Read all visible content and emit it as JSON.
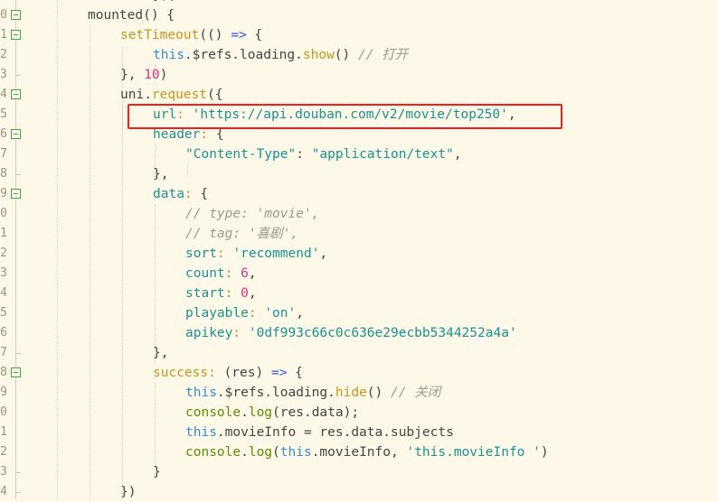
{
  "editor": {
    "line_numbers": [
      "0",
      "1",
      "2",
      "3",
      "4",
      "5",
      "6",
      "7",
      "8",
      "9",
      "0",
      "1",
      "2",
      "3",
      "4",
      "5",
      "6",
      "7",
      "8",
      "9",
      "0",
      "1",
      "2",
      "3",
      "4"
    ],
    "fold_lines": [
      0,
      1,
      4,
      6,
      9,
      18
    ],
    "tick_lines": [
      3,
      8,
      17,
      23,
      24
    ],
    "highlight": {
      "color": "#f01e1e",
      "line": 5
    },
    "lines": [
      {
        "indent": 2,
        "tokens": [
          [
            "}),",
            "def"
          ]
        ]
      },
      {
        "indent": 0,
        "tokens": [
          [
            "mounted() {",
            "def"
          ]
        ]
      },
      {
        "indent": 1,
        "tokens": [
          [
            "setTimeout",
            "fn"
          ],
          [
            "(() ",
            "def"
          ],
          [
            "=>",
            "arrow"
          ],
          [
            " {",
            "def"
          ]
        ]
      },
      {
        "indent": 2,
        "tokens": [
          [
            "this",
            "kw"
          ],
          [
            ".$refs.loading.",
            "def"
          ],
          [
            "show",
            "fn"
          ],
          [
            "() ",
            "def"
          ],
          [
            "// 打开",
            "com"
          ]
        ]
      },
      {
        "indent": 1,
        "tokens": [
          [
            "}, ",
            "def"
          ],
          [
            "10",
            "num"
          ],
          [
            ")",
            "def"
          ]
        ]
      },
      {
        "indent": 1,
        "tokens": [
          [
            "uni.",
            "def"
          ],
          [
            "request",
            "fn"
          ],
          [
            "({",
            "def"
          ]
        ]
      },
      {
        "indent": 2,
        "tokens": [
          [
            "url",
            "key"
          ],
          [
            ": ",
            "punc"
          ],
          [
            "'https://api.douban.com/v2/movie/top250'",
            "str"
          ],
          [
            ",",
            "def"
          ]
        ]
      },
      {
        "indent": 2,
        "tokens": [
          [
            "header",
            "key"
          ],
          [
            ": ",
            "punc"
          ],
          [
            "{",
            "def"
          ]
        ]
      },
      {
        "indent": 3,
        "tokens": [
          [
            "\"Content-Type\"",
            "str"
          ],
          [
            ": ",
            "def"
          ],
          [
            "\"application/text\"",
            "str"
          ],
          [
            ",",
            "def"
          ]
        ]
      },
      {
        "indent": 2,
        "tokens": [
          [
            "},",
            "def"
          ]
        ]
      },
      {
        "indent": 2,
        "tokens": [
          [
            "data",
            "key"
          ],
          [
            ": ",
            "punc"
          ],
          [
            "{",
            "def"
          ]
        ]
      },
      {
        "indent": 3,
        "tokens": [
          [
            "// type: 'movie',",
            "com"
          ]
        ]
      },
      {
        "indent": 3,
        "tokens": [
          [
            "// tag: '喜剧',",
            "com"
          ]
        ]
      },
      {
        "indent": 3,
        "tokens": [
          [
            "sort",
            "key"
          ],
          [
            ": ",
            "punc"
          ],
          [
            "'recommend'",
            "str"
          ],
          [
            ",",
            "def"
          ]
        ]
      },
      {
        "indent": 3,
        "tokens": [
          [
            "count",
            "key"
          ],
          [
            ": ",
            "punc"
          ],
          [
            "6",
            "num"
          ],
          [
            ",",
            "def"
          ]
        ]
      },
      {
        "indent": 3,
        "tokens": [
          [
            "start",
            "key"
          ],
          [
            ": ",
            "punc"
          ],
          [
            "0",
            "num"
          ],
          [
            ",",
            "def"
          ]
        ]
      },
      {
        "indent": 3,
        "tokens": [
          [
            "playable",
            "key"
          ],
          [
            ": ",
            "punc"
          ],
          [
            "'on'",
            "str"
          ],
          [
            ",",
            "def"
          ]
        ]
      },
      {
        "indent": 3,
        "tokens": [
          [
            "apikey",
            "key"
          ],
          [
            ": ",
            "punc"
          ],
          [
            "'0df993c66c0c636e29ecbb5344252a4a'",
            "str"
          ]
        ]
      },
      {
        "indent": 2,
        "tokens": [
          [
            "},",
            "def"
          ]
        ]
      },
      {
        "indent": 2,
        "tokens": [
          [
            "success",
            "fn"
          ],
          [
            ": ",
            "punc"
          ],
          [
            "(res) ",
            "def"
          ],
          [
            "=>",
            "arrow"
          ],
          [
            " {",
            "def"
          ]
        ]
      },
      {
        "indent": 3,
        "tokens": [
          [
            "this",
            "kw"
          ],
          [
            ".$refs.loading.",
            "def"
          ],
          [
            "hide",
            "fn"
          ],
          [
            "() ",
            "def"
          ],
          [
            "// 关闭",
            "com"
          ]
        ]
      },
      {
        "indent": 3,
        "tokens": [
          [
            "console",
            "con"
          ],
          [
            ".",
            "def"
          ],
          [
            "log",
            "con"
          ],
          [
            "(res.data);",
            "def"
          ]
        ]
      },
      {
        "indent": 3,
        "tokens": [
          [
            "this",
            "kw"
          ],
          [
            ".movieInfo = res.data.subjects",
            "def"
          ]
        ]
      },
      {
        "indent": 3,
        "tokens": [
          [
            "console",
            "con"
          ],
          [
            ".",
            "def"
          ],
          [
            "log",
            "con"
          ],
          [
            "(",
            "def"
          ],
          [
            "this",
            "kw"
          ],
          [
            ".movieInfo, ",
            "def"
          ],
          [
            "'this.movieInfo '",
            "str"
          ],
          [
            ")",
            "def"
          ]
        ]
      },
      {
        "indent": 2,
        "tokens": [
          [
            "}",
            "def"
          ]
        ]
      },
      {
        "indent": 1,
        "tokens": [
          [
            "})",
            "def"
          ]
        ]
      }
    ]
  }
}
